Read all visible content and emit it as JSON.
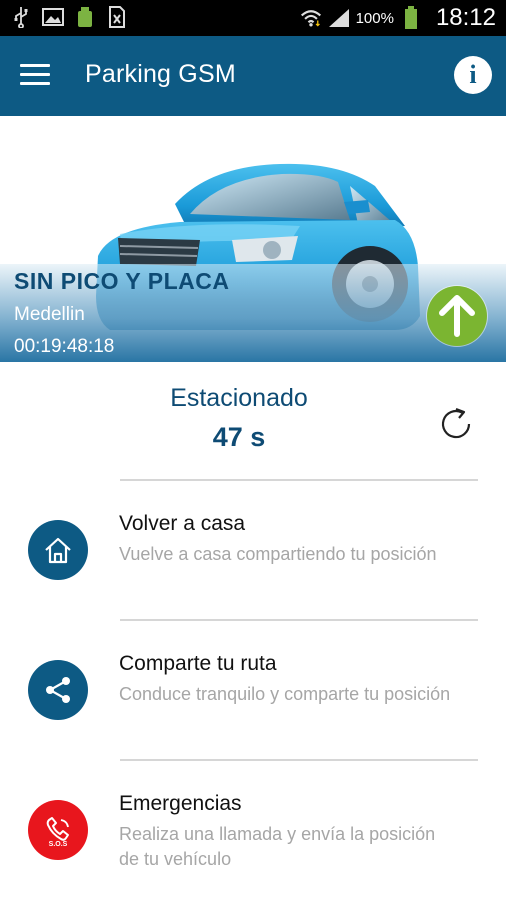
{
  "status_bar": {
    "battery": "100%",
    "time": "18:12",
    "icons": [
      "usb-icon",
      "image-icon",
      "android-icon",
      "sim-icon",
      "wifi-icon",
      "signal-icon",
      "battery-icon"
    ]
  },
  "app_bar": {
    "title": "Parking GSM",
    "menu_icon": "hamburger-menu-icon",
    "info_icon": "info-icon",
    "color": "#0d5a84"
  },
  "hero": {
    "plate_status": "SIN PICO Y PLACA",
    "city": "Medellin",
    "elapsed": "00:19:48:18",
    "action_icon": "arrow-up-icon",
    "action_color": "#7bb531"
  },
  "parking": {
    "status": "Estacionado",
    "time": "47 s",
    "refresh_icon": "refresh-icon"
  },
  "menu": [
    {
      "title": "Volver a casa",
      "subtitle": "Vuelve a casa compartiendo tu posición",
      "icon": "home-icon",
      "color": "#0d5a84"
    },
    {
      "title": "Comparte tu ruta",
      "subtitle": "Conduce tranquilo y comparte tu posición",
      "icon": "share-icon",
      "color": "#0d5a84"
    },
    {
      "title": "Emergencias",
      "subtitle": "Realiza una llamada y envía la posición de tu vehículo",
      "icon": "sos-phone-icon",
      "color": "#e8161d",
      "badge": "S.O.S"
    }
  ]
}
